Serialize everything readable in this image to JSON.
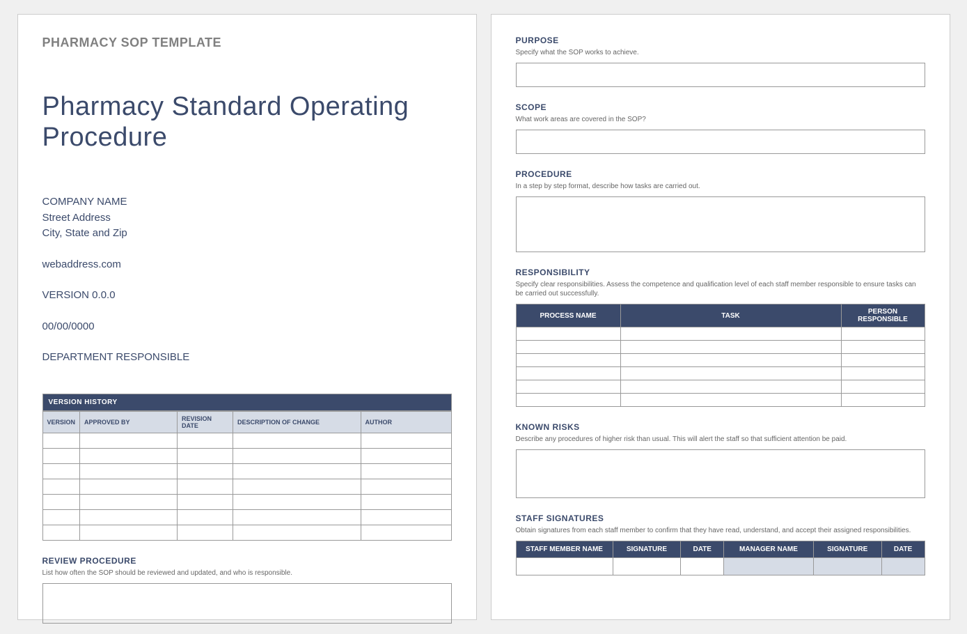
{
  "page1": {
    "header": "PHARMACY SOP TEMPLATE",
    "title": "Pharmacy Standard Operating Procedure",
    "company": "COMPANY NAME",
    "street": "Street Address",
    "city": "City, State and Zip",
    "web": "webaddress.com",
    "version": "VERSION 0.0.0",
    "date": "00/00/0000",
    "dept": "DEPARTMENT RESPONSIBLE",
    "version_history_label": "VERSION HISTORY",
    "vh_cols": {
      "c1": "VERSION",
      "c2": "APPROVED BY",
      "c3": "REVISION DATE",
      "c4": "DESCRIPTION OF CHANGE",
      "c5": "AUTHOR"
    },
    "review_heading": "REVIEW PROCEDURE",
    "review_desc": "List how often the SOP should be reviewed and updated, and who is responsible."
  },
  "page2": {
    "purpose_heading": "PURPOSE",
    "purpose_desc": "Specify what the SOP works to achieve.",
    "scope_heading": "SCOPE",
    "scope_desc": "What work areas are covered in the SOP?",
    "procedure_heading": "PROCEDURE",
    "procedure_desc": "In a step by step format, describe how tasks are carried out.",
    "responsibility_heading": "RESPONSIBILITY",
    "responsibility_desc": "Specify clear responsibilities.  Assess the competence and qualification level of each staff member responsible to ensure tasks can be carried out successfully.",
    "resp_cols": {
      "c1": "PROCESS NAME",
      "c2": "TASK",
      "c3": "PERSON RESPONSIBLE"
    },
    "risks_heading": "KNOWN RISKS",
    "risks_desc": "Describe any procedures of higher risk than usual.  This will alert the staff so that sufficient attention be paid.",
    "sig_heading": "STAFF SIGNATURES",
    "sig_desc": "Obtain signatures from each staff member to confirm that they have read, understand, and accept their assigned responsibilities.",
    "sig_cols": {
      "c1": "STAFF MEMBER NAME",
      "c2": "SIGNATURE",
      "c3": "DATE",
      "c4": "MANAGER NAME",
      "c5": "SIGNATURE",
      "c6": "DATE"
    }
  }
}
